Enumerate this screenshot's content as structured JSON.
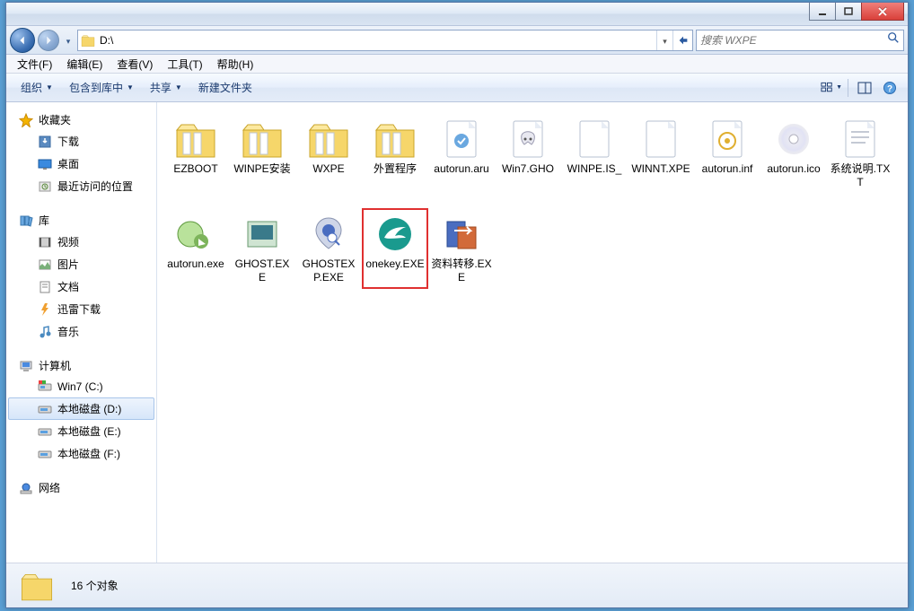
{
  "window": {
    "min": "minimize",
    "max": "maximize",
    "close": "close"
  },
  "nav": {
    "path": "D:\\",
    "search_placeholder": "搜索 WXPE"
  },
  "menus": {
    "file": "文件(F)",
    "edit": "编辑(E)",
    "view": "查看(V)",
    "tools": "工具(T)",
    "help": "帮助(H)"
  },
  "toolbar": {
    "organize": "组织",
    "include": "包含到库中",
    "share": "共享",
    "newfolder": "新建文件夹"
  },
  "sidebar": {
    "favorites": {
      "label": "收藏夹",
      "items": [
        "下载",
        "桌面",
        "最近访问的位置"
      ]
    },
    "libraries": {
      "label": "库",
      "items": [
        "视频",
        "图片",
        "文档",
        "迅雷下载",
        "音乐"
      ]
    },
    "computer": {
      "label": "计算机",
      "items": [
        "Win7 (C:)",
        "本地磁盘 (D:)",
        "本地磁盘 (E:)",
        "本地磁盘 (F:)"
      ],
      "selected_index": 1
    },
    "network": {
      "label": "网络"
    }
  },
  "files": [
    {
      "name": "EZBOOT",
      "icon": "folder"
    },
    {
      "name": "WINPE安装",
      "icon": "folder"
    },
    {
      "name": "WXPE",
      "icon": "folder"
    },
    {
      "name": "外置程序",
      "icon": "folder"
    },
    {
      "name": "autorun.aru",
      "icon": "aru"
    },
    {
      "name": "Win7.GHO",
      "icon": "gho"
    },
    {
      "name": "WINPE.IS_",
      "icon": "blank"
    },
    {
      "name": "WINNT.XPE",
      "icon": "blank"
    },
    {
      "name": "autorun.inf",
      "icon": "inf"
    },
    {
      "name": "autorun.ico",
      "icon": "disc"
    },
    {
      "name": "系统说明.TXT",
      "icon": "txt"
    },
    {
      "name": "autorun.exe",
      "icon": "exe1"
    },
    {
      "name": "GHOST.EXE",
      "icon": "exe2"
    },
    {
      "name": "GHOSTEXP.EXE",
      "icon": "exe3"
    },
    {
      "name": "onekey.EXE",
      "icon": "onekey",
      "highlighted": true
    },
    {
      "name": "资料转移.EXE",
      "icon": "exe4"
    }
  ],
  "status": {
    "count_text": "16 个对象"
  }
}
